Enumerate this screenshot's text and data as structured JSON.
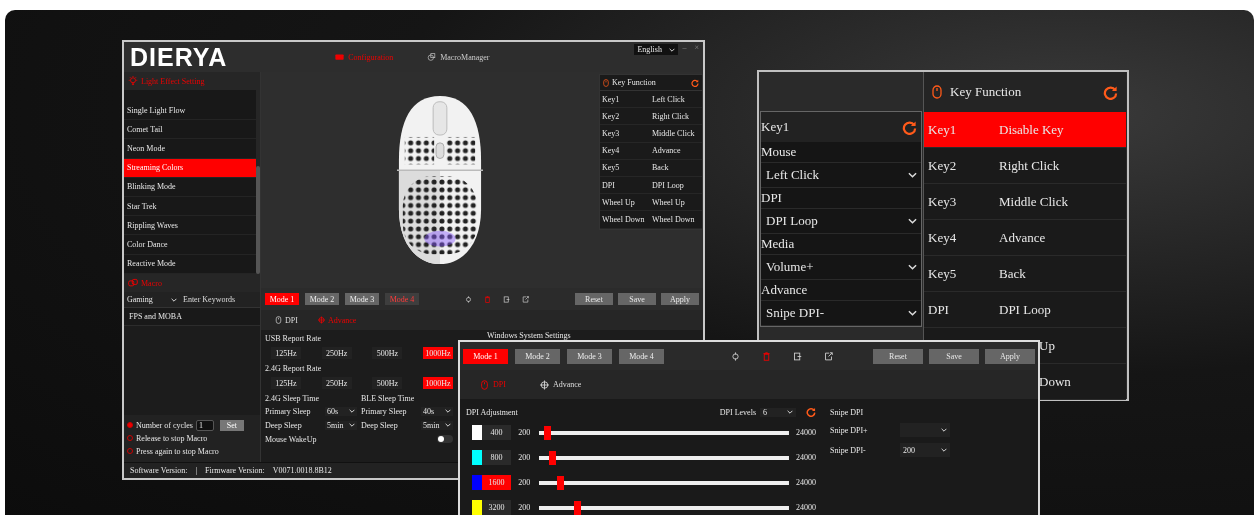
{
  "main": {
    "logo": "DIERYA",
    "nav": [
      {
        "label": "Configuration",
        "selected": true
      },
      {
        "label": "MacroManager",
        "selected": false
      }
    ],
    "language": "English",
    "window_controls": [
      "–",
      "×"
    ],
    "light_panel": {
      "title": "Light Effect Setting",
      "items": [
        {
          "label": "Single Light Flow",
          "selected": false
        },
        {
          "label": "Comet Tail",
          "selected": false
        },
        {
          "label": "Neon Mode",
          "selected": false
        },
        {
          "label": "Streaming Colors",
          "selected": true
        },
        {
          "label": "Blinking Mode",
          "selected": false
        },
        {
          "label": "Star Trek",
          "selected": false
        },
        {
          "label": "Rippling Waves",
          "selected": false
        },
        {
          "label": "Color Dance",
          "selected": false
        },
        {
          "label": "Reactive Mode",
          "selected": false
        }
      ]
    },
    "macro": {
      "title": "Macro",
      "category": "Gaming",
      "search_placeholder": "Enter Keywords",
      "items": [
        "FPS and MOBA"
      ],
      "cycles_input": "1",
      "set_button": "Set",
      "options": [
        {
          "label": "Number of cycles",
          "selected": true
        },
        {
          "label": "Release to stop Macro",
          "selected": false
        },
        {
          "label": "Press again to stop Macro",
          "selected": false
        }
      ]
    },
    "key_function": {
      "title": "Key Function",
      "rows": [
        {
          "key": "Key1",
          "value": "Left Click"
        },
        {
          "key": "Key2",
          "value": "Right Click"
        },
        {
          "key": "Key3",
          "value": "Middle Click"
        },
        {
          "key": "Key4",
          "value": "Advance"
        },
        {
          "key": "Key5",
          "value": "Back"
        },
        {
          "key": "DPI",
          "value": "DPI Loop"
        },
        {
          "key": "Wheel Up",
          "value": "Wheel Up"
        },
        {
          "key": "Wheel Down",
          "value": "Wheel Down"
        }
      ]
    },
    "modes": [
      {
        "label": "Mode 1",
        "selected": true,
        "accent": false
      },
      {
        "label": "Mode 2",
        "selected": false,
        "accent": false
      },
      {
        "label": "Mode 3",
        "selected": false,
        "accent": false
      },
      {
        "label": "Mode 4",
        "selected": false,
        "accent": true
      }
    ],
    "actions": [
      "Reset",
      "Save",
      "Apply"
    ],
    "subtabs": [
      {
        "label": "DPI",
        "selected": false
      },
      {
        "label": "Advance",
        "selected": true
      }
    ],
    "rates": [
      {
        "label": "USB Report Rate",
        "options": [
          {
            "label": "125Hz",
            "selected": false
          },
          {
            "label": "250Hz",
            "selected": false
          },
          {
            "label": "500Hz",
            "selected": false
          },
          {
            "label": "1000Hz",
            "selected": true
          }
        ]
      },
      {
        "label": "2.4G Report Rate",
        "options": [
          {
            "label": "125Hz",
            "selected": false
          },
          {
            "label": "250Hz",
            "selected": false
          },
          {
            "label": "500Hz",
            "selected": false
          },
          {
            "label": "1000Hz",
            "selected": true
          }
        ]
      }
    ],
    "sleep": [
      {
        "title": "2.4G Sleep Time",
        "primary_label": "Primary Sleep",
        "primary": "60s",
        "deep_label": "Deep Sleep",
        "deep": "5min"
      },
      {
        "title": "BLE Sleep Time",
        "primary_label": "Primary Sleep",
        "primary": "40s",
        "deep_label": "Deep Sleep",
        "deep": "5min"
      }
    ],
    "wakeup": {
      "label": "Mouse WakeUp",
      "on": false
    },
    "system_settings_title": "Windows System Settings",
    "footer": {
      "software_label": "Software Version:",
      "separator": "|",
      "firmware_label": "Firmware Version:",
      "firmware": "V0071.0018.8B12"
    }
  },
  "key_editor": {
    "title": "Key1",
    "groups": [
      {
        "label": "Mouse",
        "value": "Left Click"
      },
      {
        "label": "DPI",
        "value": "DPI Loop"
      },
      {
        "label": "Media",
        "value": "Volume+"
      },
      {
        "label": "Advance",
        "value": "Snipe DPI-"
      }
    ],
    "key_function": {
      "title": "Key Function",
      "rows": [
        {
          "key": "Key1",
          "value": "Disable Key",
          "selected": true
        },
        {
          "key": "Key2",
          "value": "Right Click",
          "selected": false
        },
        {
          "key": "Key3",
          "value": "Middle Click",
          "selected": false
        },
        {
          "key": "Key4",
          "value": "Advance",
          "selected": false
        },
        {
          "key": "Key5",
          "value": "Back",
          "selected": false
        },
        {
          "key": "DPI",
          "value": "DPI Loop",
          "selected": false
        },
        {
          "kind": "cut",
          "value": "Up",
          "selected": false
        },
        {
          "kind": "cut",
          "value": "Down",
          "selected": false
        }
      ]
    }
  },
  "dpi_panel": {
    "modes": [
      {
        "label": "Mode 1",
        "selected": true,
        "accent": false
      },
      {
        "label": "Mode 2",
        "selected": false,
        "accent": false
      },
      {
        "label": "Mode 3",
        "selected": false,
        "accent": false
      },
      {
        "label": "Mode 4",
        "selected": false,
        "accent": false
      }
    ],
    "actions": [
      "Reset",
      "Save",
      "Apply"
    ],
    "subtabs": [
      {
        "label": "DPI",
        "selected": true
      },
      {
        "label": "Advance",
        "selected": false
      }
    ],
    "adjustment_title": "DPI Adjustment",
    "levels_label": "DPI Levels",
    "levels": "6",
    "rows": [
      {
        "color": "#ffffff",
        "value": "400",
        "min": "200",
        "max": "24000",
        "level": 0.02,
        "selected": false
      },
      {
        "color": "#00ffff",
        "value": "800",
        "min": "200",
        "max": "24000",
        "level": 0.04,
        "selected": false
      },
      {
        "color": "#0000ff",
        "value": "1600",
        "min": "200",
        "max": "24000",
        "level": 0.07,
        "selected": true
      },
      {
        "color": "#ffff00",
        "value": "3200",
        "min": "200",
        "max": "24000",
        "level": 0.14,
        "selected": false
      }
    ],
    "snipe": {
      "title": "Snipe DPI",
      "plus_label": "Snipe DPI+",
      "minus_label": "Snipe DPI-",
      "minus": "200"
    }
  }
}
